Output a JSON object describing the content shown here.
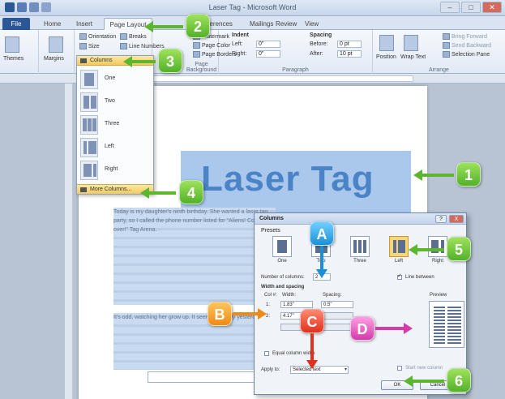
{
  "window": {
    "title": "Laser Tag - Microsoft Word"
  },
  "tabs": [
    {
      "label": "File"
    },
    {
      "label": "Home"
    },
    {
      "label": "Insert"
    },
    {
      "label": "Page Layout"
    },
    {
      "label": "References"
    },
    {
      "label": "Mailings"
    },
    {
      "label": "Review"
    },
    {
      "label": "View"
    }
  ],
  "ribbon": {
    "orientation_label": "Orientation",
    "breaks_label": "Breaks",
    "size_label": "Size",
    "line_numbers_label": "Line Numbers",
    "margins_label": "Margins",
    "watermark_label": "Watermark",
    "page_color_label": "Page Color",
    "page_borders_label": "Page Borders",
    "page_background_group": "Page Background",
    "indent_label": "Indent",
    "indent_left_label": "Left:",
    "indent_left_value": "0\"",
    "indent_right_label": "Right:",
    "indent_right_value": "0\"",
    "spacing_label": "Spacing",
    "spacing_before_label": "Before:",
    "spacing_before_value": "0 pt",
    "spacing_after_label": "After:",
    "spacing_after_value": "10 pt",
    "paragraph_group": "Paragraph",
    "position_label": "Position",
    "wrap_text_label": "Wrap Text",
    "bring_forward_label": "Bring Forward",
    "send_backward_label": "Send Backward",
    "selection_pane_label": "Selection Pane",
    "arrange_group": "Arrange",
    "themes_label": "Themes"
  },
  "columns_menu": {
    "header": "Columns",
    "items": [
      {
        "label": "One"
      },
      {
        "label": "Two"
      },
      {
        "label": "Three"
      },
      {
        "label": "Left"
      },
      {
        "label": "Right"
      }
    ],
    "more": "More Columns..."
  },
  "document": {
    "heading": "Laser Tag",
    "para1": "Today is my daughter's ninth birthday. She wanted a laser tag party, so I called the phone number listed for \"Aliens! Come over!\" Tag Arena.",
    "para2": "It's odd, watching her grow up. It seems like only yesterday..."
  },
  "dialog": {
    "title": "Columns",
    "help": "?",
    "close": "X",
    "presets_label": "Presets",
    "presets": [
      {
        "label": "One"
      },
      {
        "label": "Two"
      },
      {
        "label": "Three"
      },
      {
        "label": "Left"
      },
      {
        "label": "Right"
      }
    ],
    "num_columns_label": "Number of columns:",
    "num_columns_value": "2",
    "line_between_label": "Line between",
    "width_spacing_label": "Width and spacing",
    "col_header": "Col #:",
    "width_header": "Width:",
    "spacing_header": "Spacing:",
    "rows": [
      {
        "col": "1:",
        "width": "1.83\"",
        "spacing": "0.5\""
      },
      {
        "col": "2:",
        "width": "4.17\"",
        "spacing": ""
      }
    ],
    "equal_width_label": "Equal column width",
    "apply_to_label": "Apply to:",
    "apply_to_value": "Selected text",
    "preview_label": "Preview",
    "start_new_label": "Start new column",
    "ok_label": "OK",
    "cancel_label": "Cancel"
  },
  "callouts": {
    "c1": "1",
    "c2": "2",
    "c3": "3",
    "c4": "4",
    "c5": "5",
    "c6": "6",
    "cA": "A",
    "cB": "B",
    "cC": "C",
    "cD": "D"
  }
}
